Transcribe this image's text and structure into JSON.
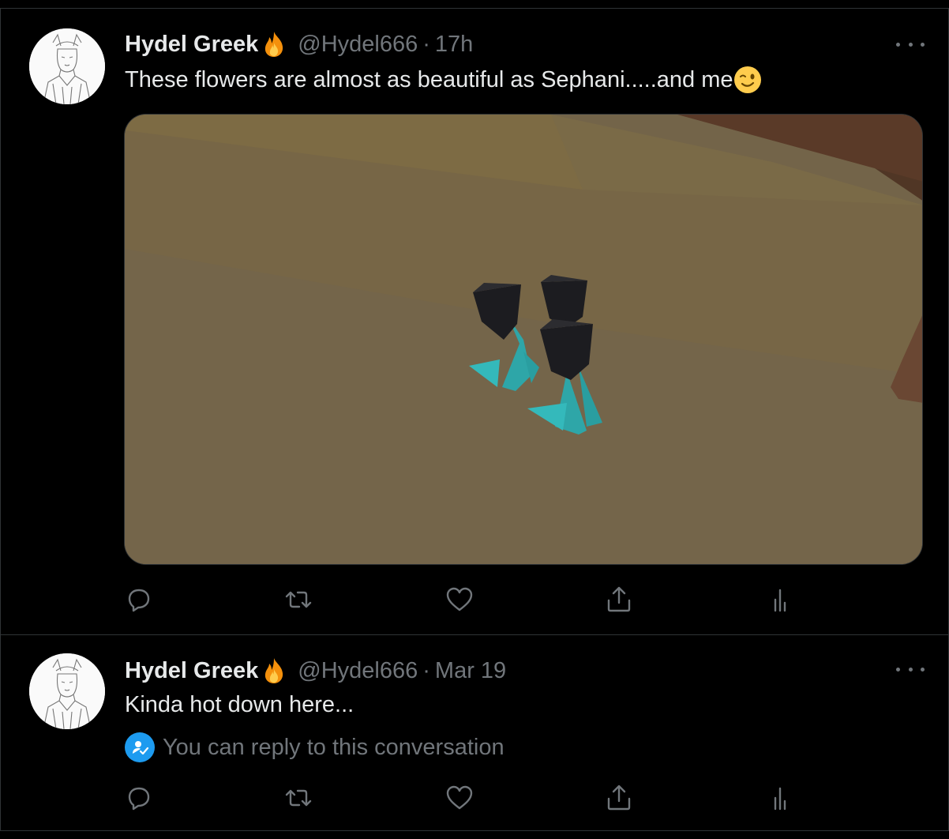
{
  "tweets": [
    {
      "author_name": "Hydel Greek",
      "author_emoji": "flame-emoji",
      "handle": "@Hydel666",
      "separator": "·",
      "time": "17h",
      "text": "These flowers are almost as beautiful as Sephani.....and me",
      "text_emoji": "winking-face-emoji",
      "media": "low-poly-black-flowers-image"
    },
    {
      "author_name": "Hydel Greek",
      "author_emoji": "flame-emoji",
      "handle": "@Hydel666",
      "separator": "·",
      "time": "Mar 19",
      "text": "Kinda hot down here...",
      "reply_note": "You can reply to this conversation"
    }
  ],
  "actions": [
    "reply-icon",
    "retweet-icon",
    "like-icon",
    "share-icon",
    "analytics-icon"
  ],
  "colors": {
    "background": "#000000",
    "text_primary": "#e7e9ea",
    "text_secondary": "#71767b",
    "border": "#2f3336",
    "accent": "#1d9bf0"
  }
}
